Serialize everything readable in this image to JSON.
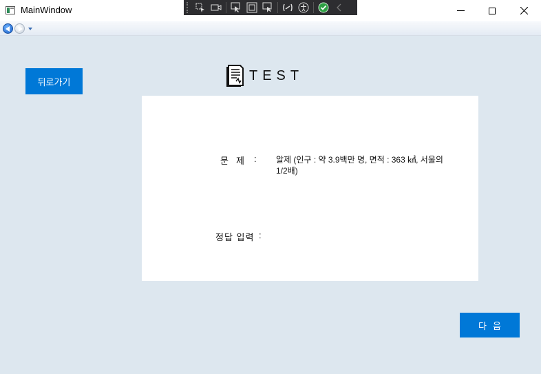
{
  "window": {
    "title": "MainWindow"
  },
  "toolbar": {
    "tools": [
      "select-element-icon",
      "record-icon",
      "pointer-icon",
      "display-layout-icon",
      "track-focus-icon",
      "binding-icon",
      "accessibility-icon",
      "check-icon",
      "collapse-icon"
    ]
  },
  "nav": {
    "back_icon": "back-arrow-icon",
    "forward_icon": "forward-arrow-icon"
  },
  "page": {
    "back_label": "뒤로가기",
    "header_icon": "certificate-document-icon",
    "title": "TEST",
    "question_label": "문제",
    "question_colon": ":",
    "question_text": "알제 (인구 : 약 3.9백만 명, 면적 : 363 ㎢, 서울의 1/2배)",
    "answer_label": "정답 입력",
    "answer_colon": ":",
    "answer_value": "",
    "next_label": "다음"
  },
  "colors": {
    "accent": "#0078d7",
    "background": "#dde7ef",
    "card": "#ffffff"
  }
}
